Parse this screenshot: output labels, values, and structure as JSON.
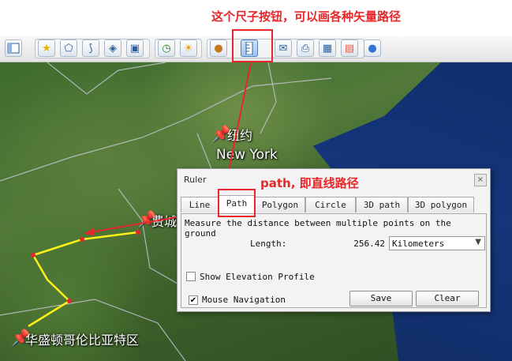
{
  "annotation_top": "这个尺子按钮，可以画各种矢量路径",
  "annotation_path": "path, 即直线路径",
  "toolbar": {
    "buttons": [
      {
        "name": "sidebar-toggle-button",
        "icon": "sidebar-icon"
      },
      {
        "name": "add-placemark-button",
        "icon": "placemark-icon"
      },
      {
        "name": "add-polygon-button",
        "icon": "polygon-icon"
      },
      {
        "name": "add-path-button",
        "icon": "path-icon"
      },
      {
        "name": "add-image-overlay-button",
        "icon": "overlay-icon"
      },
      {
        "name": "record-tour-button",
        "icon": "tour-icon"
      },
      {
        "name": "historical-imagery-button",
        "icon": "clock-icon"
      },
      {
        "name": "sunlight-button",
        "icon": "sun-icon"
      },
      {
        "name": "planets-button",
        "icon": "planet-icon"
      },
      {
        "name": "ruler-button",
        "icon": "ruler-icon"
      },
      {
        "name": "email-button",
        "icon": "email-icon"
      },
      {
        "name": "print-button",
        "icon": "print-icon"
      },
      {
        "name": "save-image-button",
        "icon": "image-icon"
      },
      {
        "name": "view-in-maps-button",
        "icon": "maps-icon"
      }
    ]
  },
  "map": {
    "labels": {
      "newyork_cn": "纽约",
      "newyork_en": "New York",
      "philly_cn": "费城",
      "dc_cn": "华盛顿哥伦比亚特区"
    }
  },
  "ruler": {
    "title": "Ruler",
    "close": "×",
    "tabs": [
      "Line",
      "Path",
      "Polygon",
      "Circle",
      "3D path",
      "3D polygon"
    ],
    "active_tab": "Path",
    "description": "Measure the distance between multiple points on the ground",
    "length_label": "Length:",
    "length_value": "256.42",
    "unit": "Kilometers",
    "show_elevation": "Show Elevation Profile",
    "show_elevation_checked": false,
    "mouse_navigation": "Mouse Navigation",
    "mouse_navigation_checked": true,
    "save": "Save",
    "clear": "Clear"
  },
  "colors": {
    "annotation": "#e8262a",
    "path_line": "#ffef1a",
    "path_point": "#e8262a"
  }
}
